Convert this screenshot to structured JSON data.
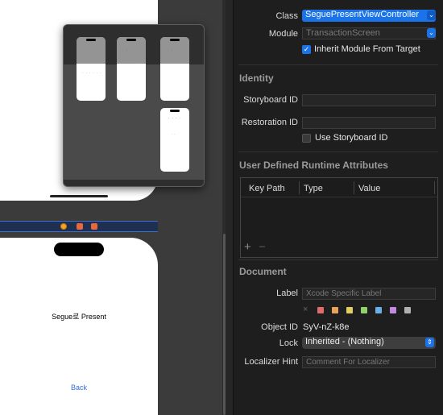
{
  "canvas": {
    "scene_title": "Segue로 Present",
    "back_label": "Back"
  },
  "inspector": {
    "class_label": "Class",
    "class_value": "SeguePresentViewController",
    "module_label": "Module",
    "module_value": "TransactionScreen",
    "inherit_label": "Inherit Module From Target",
    "identity_header": "Identity",
    "storyboard_id_label": "Storyboard ID",
    "storyboard_id_value": "",
    "restoration_id_label": "Restoration ID",
    "restoration_id_value": "",
    "use_storyboard_id_label": "Use Storyboard ID",
    "udra_header": "User Defined Runtime Attributes",
    "table_columns": [
      "Key Path",
      "Type",
      "Value"
    ],
    "document_header": "Document",
    "doc_label_label": "Label",
    "doc_label_placeholder": "Xcode Specific Label",
    "object_id_label": "Object ID",
    "object_id_value": "SyV-nZ-k8e",
    "lock_label": "Lock",
    "lock_value": "Inherited - (Nothing)",
    "localizer_label": "Localizer Hint",
    "localizer_placeholder": "Comment For Localizer",
    "label_colors": [
      "#e06b6b",
      "#e8a25a",
      "#e0cf5a",
      "#8fd16a",
      "#6ab0e8",
      "#c28ae0",
      "#b0b0b0"
    ],
    "accent_color": "#1a73e8"
  }
}
